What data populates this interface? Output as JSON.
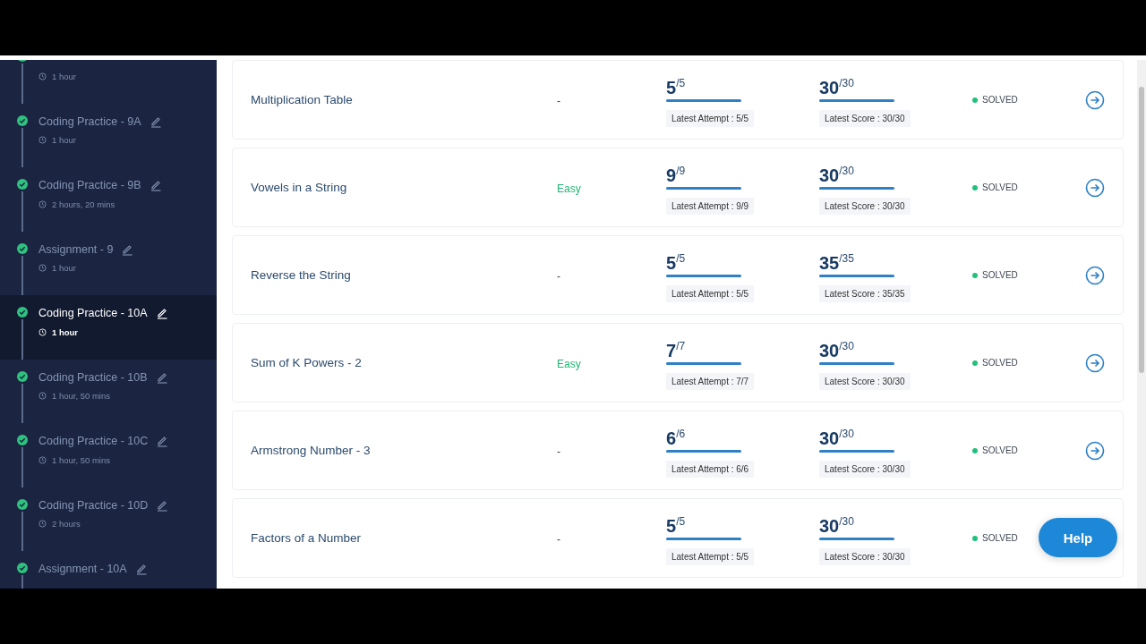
{
  "sidebar": {
    "items": [
      {
        "duration": "1 hour",
        "completed": true,
        "selected": false
      },
      {
        "title": "Coding Practice - 9A",
        "duration": "1 hour",
        "completed": true,
        "selected": false
      },
      {
        "title": "Coding Practice - 9B",
        "duration": "2 hours, 20 mins",
        "completed": true,
        "selected": false
      },
      {
        "title": "Assignment - 9",
        "duration": "1 hour",
        "completed": true,
        "selected": false
      },
      {
        "title": "Coding Practice - 10A",
        "duration": "1 hour",
        "completed": true,
        "selected": true
      },
      {
        "title": "Coding Practice - 10B",
        "duration": "1 hour, 50 mins",
        "completed": true,
        "selected": false
      },
      {
        "title": "Coding Practice - 10C",
        "duration": "1 hour, 50 mins",
        "completed": true,
        "selected": false
      },
      {
        "title": "Coding Practice - 10D",
        "duration": "2 hours",
        "completed": true,
        "selected": false
      },
      {
        "title": "Assignment - 10A",
        "completed": true,
        "selected": false
      }
    ]
  },
  "questions": [
    {
      "title": "Multiplication Table",
      "difficulty": {
        "text": "-"
      },
      "attempts": {
        "value": "5",
        "total": "/5",
        "level": 1,
        "caption": "Latest Attempt : 5/5"
      },
      "score": {
        "value": "30",
        "total": "/30",
        "level": 1,
        "caption": "Latest Score : 30/30"
      },
      "status": {
        "text": "SOLVED",
        "color": "#22c07a"
      }
    },
    {
      "title": "Vowels in a String",
      "difficulty": {
        "text": "Easy",
        "color": "#22b573"
      },
      "attempts": {
        "value": "9",
        "total": "/9",
        "level": 1,
        "caption": "Latest Attempt : 9/9"
      },
      "score": {
        "value": "30",
        "total": "/30",
        "level": 1,
        "caption": "Latest Score : 30/30"
      },
      "status": {
        "text": "SOLVED",
        "color": "#22c07a"
      }
    },
    {
      "title": "Reverse the String",
      "difficulty": {
        "text": "-"
      },
      "attempts": {
        "value": "5",
        "total": "/5",
        "level": 1,
        "caption": "Latest Attempt : 5/5"
      },
      "score": {
        "value": "35",
        "total": "/35",
        "level": 1,
        "caption": "Latest Score : 35/35"
      },
      "status": {
        "text": "SOLVED",
        "color": "#22c07a"
      }
    },
    {
      "title": "Sum of K Powers - 2",
      "difficulty": {
        "text": "Easy",
        "color": "#22b573"
      },
      "attempts": {
        "value": "7",
        "total": "/7",
        "level": 1,
        "caption": "Latest Attempt : 7/7"
      },
      "score": {
        "value": "30",
        "total": "/30",
        "level": 1,
        "caption": "Latest Score : 30/30"
      },
      "status": {
        "text": "SOLVED",
        "color": "#22c07a"
      }
    },
    {
      "title": "Armstrong Number - 3",
      "difficulty": {
        "text": "-"
      },
      "attempts": {
        "value": "6",
        "total": "/6",
        "level": 1,
        "caption": "Latest Attempt : 6/6"
      },
      "score": {
        "value": "30",
        "total": "/30",
        "level": 1,
        "caption": "Latest Score : 30/30"
      },
      "status": {
        "text": "SOLVED",
        "color": "#22c07a"
      }
    },
    {
      "title": "Factors of a Number",
      "difficulty": {
        "text": "-"
      },
      "attempts": {
        "value": "5",
        "total": "/5",
        "level": 1,
        "caption": "Latest Attempt : 5/5"
      },
      "score": {
        "value": "30",
        "total": "/30",
        "level": 1,
        "caption": "Latest Score : 30/30"
      },
      "status": {
        "text": "SOLVED",
        "color": "#22c07a"
      }
    }
  ],
  "help_button": {
    "label": "Help"
  }
}
